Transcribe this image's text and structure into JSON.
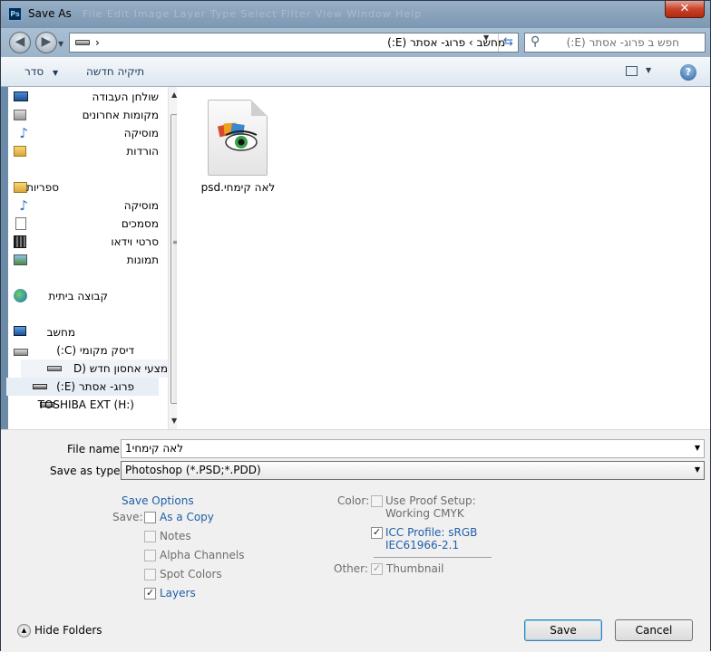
{
  "window": {
    "title": "Save As",
    "app_icon": "photoshop-icon",
    "faded_menu": "File   Edit   Image   Layer   Type   Select   Filter   View   Window   Help"
  },
  "address_bar": {
    "path": [
      "מחשב",
      "פרוג- אסתר (E:)"
    ],
    "separator": "›",
    "search_placeholder": "חפש ב פרוג- אסתר (E:)"
  },
  "toolbar": {
    "organize": "סדר",
    "new_folder": "תיקיה חדשה"
  },
  "nav": {
    "favorites": [
      {
        "label": "שולחן העבודה",
        "icon": "desktop-icon"
      },
      {
        "label": "מקומות אחרונים",
        "icon": "recent-places-icon"
      },
      {
        "label": "מוסיקה",
        "icon": "music-icon"
      },
      {
        "label": "הורדות",
        "icon": "downloads-icon"
      }
    ],
    "libraries_header": "ספריות",
    "libraries": [
      {
        "label": "מוסיקה",
        "icon": "music-icon"
      },
      {
        "label": "מסמכים",
        "icon": "documents-icon"
      },
      {
        "label": "סרטי וידאו",
        "icon": "video-icon"
      },
      {
        "label": "תמונות",
        "icon": "pictures-icon"
      }
    ],
    "homegroup": "קבוצה ביתית",
    "computer_header": "מחשב",
    "drives": [
      {
        "label": "דיסק מקומי (C:)",
        "icon": "local-disk-icon"
      },
      {
        "label": "אמצעי אחסון חדש (D",
        "icon": "drive-icon"
      },
      {
        "label": "פרוג- אסתר (E:)",
        "icon": "drive-icon"
      },
      {
        "label": "TOSHIBA EXT (H:)",
        "icon": "drive-icon"
      }
    ]
  },
  "files": [
    {
      "name": "לאה קימחי.psd",
      "icon": "psd-file-icon"
    }
  ],
  "form": {
    "file_name_label": "File name:",
    "file_name_value": "לאה קימחי1",
    "save_type_label": "Save as type:",
    "save_type_value": "Photoshop (*.PSD;*.PDD)"
  },
  "save_options": {
    "title": "Save Options",
    "save_label": "Save:",
    "as_a_copy": {
      "label": "As a Copy",
      "checked": false
    },
    "notes": {
      "label": "Notes",
      "checked": false
    },
    "alpha_channels": {
      "label": "Alpha Channels",
      "checked": false
    },
    "spot_colors": {
      "label": "Spot Colors",
      "checked": false
    },
    "layers": {
      "label": "Layers",
      "checked": true
    },
    "color_label": "Color:",
    "use_proof_setup_1": "Use Proof Setup:",
    "use_proof_setup_2": "Working CMYK",
    "icc_profile_1": "ICC Profile:  sRGB",
    "icc_profile_2": "IEC61966-2.1",
    "other_label": "Other:",
    "thumbnail": "Thumbnail"
  },
  "footer": {
    "hide_folders": "Hide Folders",
    "save": "Save",
    "cancel": "Cancel"
  },
  "colors": {
    "link": "#1f5fa8",
    "titlebar": "#7c97b1",
    "close": "#c8432a"
  }
}
